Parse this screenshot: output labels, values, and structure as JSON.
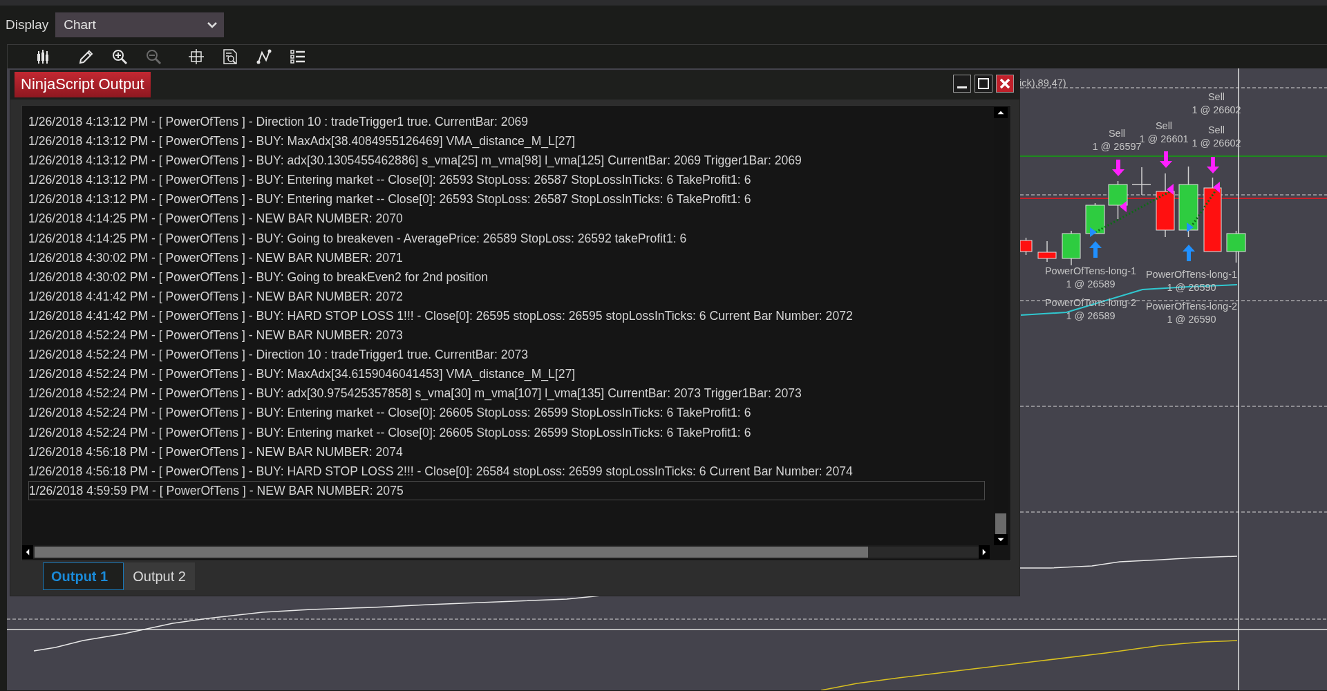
{
  "display": {
    "label": "Display",
    "value": "Chart"
  },
  "toolbar": [
    {
      "kind": "bars",
      "disabled": false
    },
    {
      "kind": "pencil",
      "disabled": false
    },
    {
      "kind": "zoom-in",
      "disabled": false
    },
    {
      "kind": "zoom-out",
      "disabled": true
    },
    {
      "kind": "crosshair",
      "disabled": false
    },
    {
      "kind": "data-box",
      "disabled": false
    },
    {
      "kind": "drawing",
      "disabled": false
    },
    {
      "kind": "list",
      "disabled": false
    }
  ],
  "chart": {
    "legend_fragment": "ick),89,47)",
    "sell_labels": [
      {
        "title": "Sell",
        "fill": "1 @ 26602"
      },
      {
        "title": "Sell",
        "fill": "1 @ 26597"
      },
      {
        "title": "Sell",
        "fill": "1 @ 26601"
      },
      {
        "title": "Sell",
        "fill": "1 @ 26602"
      }
    ],
    "entry_labels": [
      {
        "title": "PowerOfTens-long-1",
        "fill": "1 @ 26589"
      },
      {
        "title": "PowerOfTens-long-1",
        "fill": "1 @ 26590"
      },
      {
        "title": "PowerOfTens-long-2",
        "fill": "1 @ 26589"
      },
      {
        "title": "PowerOfTens-long-2",
        "fill": "1 @ 26590"
      }
    ]
  },
  "output_window": {
    "title": "NinjaScript Output",
    "lines": [
      {
        "text": "1/26/2018 4:13:12 PM - [ PowerOfTens ] - Direction 10 : tradeTrigger1 true. CurrentBar: 2069",
        "selected": false
      },
      {
        "text": "1/26/2018 4:13:12 PM - [ PowerOfTens ] - BUY: MaxAdx[38.4084955126469] VMA_distance_M_L[27]",
        "selected": false
      },
      {
        "text": "1/26/2018 4:13:12 PM - [ PowerOfTens ] - BUY: adx[30.1305455462886] s_vma[25] m_vma[98] l_vma[125] CurrentBar: 2069 Trigger1Bar: 2069",
        "selected": false
      },
      {
        "text": "1/26/2018 4:13:12 PM - [ PowerOfTens ] - BUY: Entering market -- Close[0]: 26593 StopLoss: 26587 StopLossInTicks: 6 TakeProfit1: 6",
        "selected": false
      },
      {
        "text": "1/26/2018 4:13:12 PM - [ PowerOfTens ] - BUY: Entering market -- Close[0]: 26593 StopLoss: 26587 StopLossInTicks: 6 TakeProfit1: 6",
        "selected": false
      },
      {
        "text": "1/26/2018 4:14:25 PM - [ PowerOfTens ] - NEW BAR NUMBER: 2070",
        "selected": false
      },
      {
        "text": "1/26/2018 4:14:25 PM - [ PowerOfTens ] - BUY: Going to breakeven - AveragePrice: 26589 StopLoss: 26592 takeProfit1: 6",
        "selected": false
      },
      {
        "text": "1/26/2018 4:30:02 PM - [ PowerOfTens ] - NEW BAR NUMBER: 2071",
        "selected": false
      },
      {
        "text": "1/26/2018 4:30:02 PM - [ PowerOfTens ] - BUY: Going to breakEven2 for 2nd position",
        "selected": false
      },
      {
        "text": "1/26/2018 4:41:42 PM - [ PowerOfTens ] - NEW BAR NUMBER: 2072",
        "selected": false
      },
      {
        "text": "1/26/2018 4:41:42 PM - [ PowerOfTens ] - BUY: HARD STOP LOSS 1!!! - Close[0]: 26595 stopLoss: 26595 stopLossInTicks: 6 Current Bar Number: 2072",
        "selected": false
      },
      {
        "text": "1/26/2018 4:52:24 PM - [ PowerOfTens ] - NEW BAR NUMBER: 2073",
        "selected": false
      },
      {
        "text": "1/26/2018 4:52:24 PM - [ PowerOfTens ] - Direction 10 : tradeTrigger1 true. CurrentBar: 2073",
        "selected": false
      },
      {
        "text": "1/26/2018 4:52:24 PM - [ PowerOfTens ] - BUY: MaxAdx[34.6159046041453] VMA_distance_M_L[27]",
        "selected": false
      },
      {
        "text": "1/26/2018 4:52:24 PM - [ PowerOfTens ] - BUY: adx[30.975425357858] s_vma[30] m_vma[107] l_vma[135] CurrentBar: 2073 Trigger1Bar: 2073",
        "selected": false
      },
      {
        "text": "1/26/2018 4:52:24 PM - [ PowerOfTens ] - BUY: Entering market -- Close[0]: 26605 StopLoss: 26599 StopLossInTicks: 6 TakeProfit1: 6",
        "selected": false
      },
      {
        "text": "1/26/2018 4:52:24 PM - [ PowerOfTens ] - BUY: Entering market -- Close[0]: 26605 StopLoss: 26599 StopLossInTicks: 6 TakeProfit1: 6",
        "selected": false
      },
      {
        "text": "1/26/2018 4:56:18 PM - [ PowerOfTens ] - NEW BAR NUMBER: 2074",
        "selected": false
      },
      {
        "text": "1/26/2018 4:56:18 PM - [ PowerOfTens ] - BUY: HARD STOP LOSS 2!!! - Close[0]: 26584 stopLoss: 26599 stopLossInTicks: 6 Current Bar Number: 2074",
        "selected": false
      },
      {
        "text": "1/26/2018 4:59:59 PM - [ PowerOfTens ] - NEW BAR NUMBER: 2075",
        "selected": true
      }
    ],
    "tabs": [
      {
        "label": "Output 1",
        "selected": true
      },
      {
        "label": "Output 2",
        "selected": false
      }
    ]
  }
}
